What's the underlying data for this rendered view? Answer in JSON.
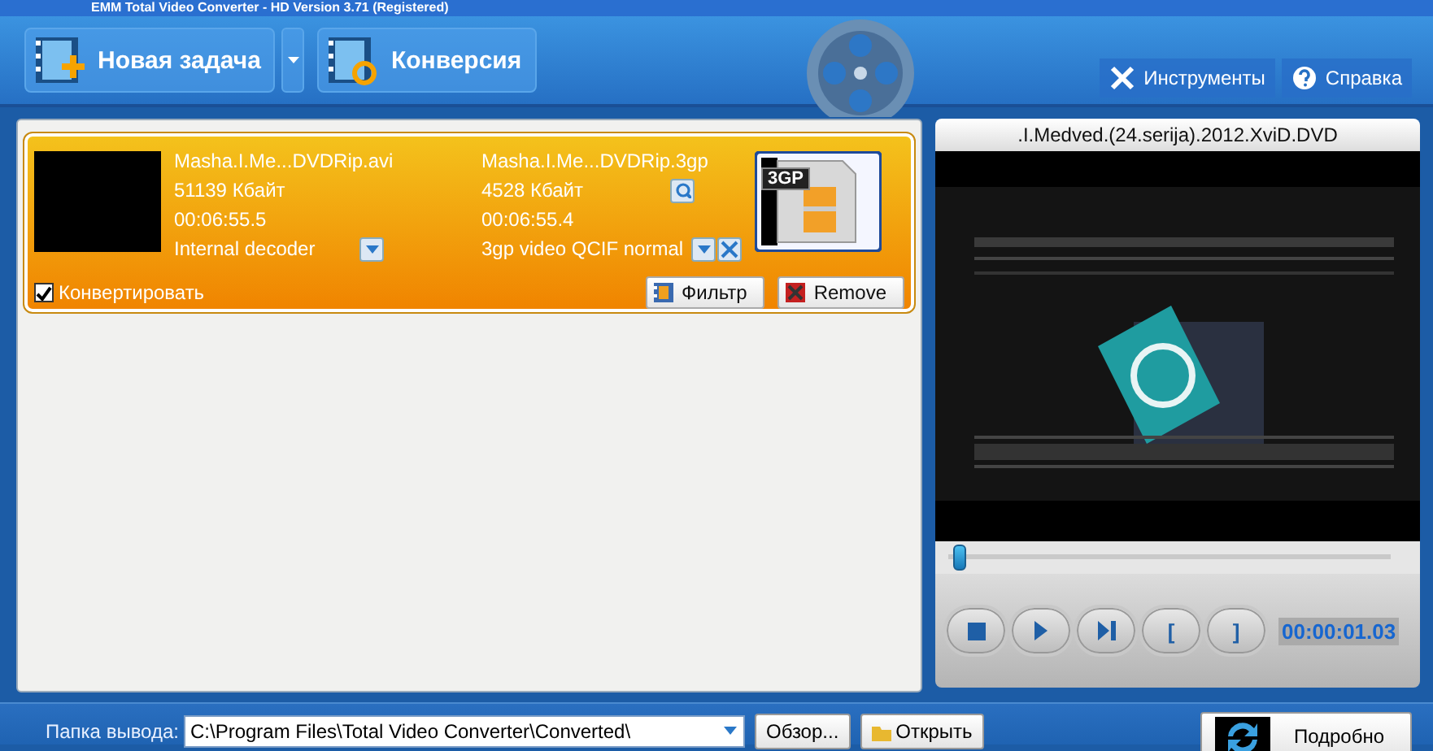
{
  "window": {
    "title": "EMM Total Video Converter - HD Version 3.71 (Registered)"
  },
  "toolbar": {
    "buttons": [
      {
        "label": "Новая задача",
        "kind": "new"
      },
      {
        "label": "Конверсия",
        "kind": "convert"
      }
    ],
    "links": [
      {
        "label": "Инструменты",
        "kind": "tools"
      },
      {
        "label": "Справка",
        "kind": "help"
      }
    ]
  },
  "tasks": [
    {
      "selected": true,
      "source": {
        "name": "Masha.I.Me...DVDRip.avi",
        "size": "51139 Кбайт",
        "duration": "00:06:55.5",
        "decoder": "Internal decoder"
      },
      "output": {
        "name": "Masha.I.Me...DVDRip.3gp",
        "size": "4528 Кбайт",
        "duration": "00:06:55.4",
        "profile": "3gp video QCIF normal"
      },
      "format_badge": "3GP",
      "convert": {
        "label": "Конвертировать",
        "checked": true
      },
      "buttons": [
        {
          "label": "Фильтр",
          "kind": "filter"
        },
        {
          "label": "Remove",
          "kind": "remove"
        }
      ]
    }
  ],
  "preview": {
    "title": ".I.Medved.(24.serija).2012.XviD.DVD",
    "seek": {
      "level": 0.01
    },
    "controls": [
      {
        "kind": "stop"
      },
      {
        "kind": "play"
      },
      {
        "kind": "next"
      },
      {
        "kind": "mark",
        "label": "["
      },
      {
        "kind": "mark",
        "label": "]"
      }
    ],
    "time": "00:00:01.03"
  },
  "output_bar": {
    "label": "Папка вывода:",
    "path": "C:\\Program Files\\Total Video Converter\\Converted\\",
    "buttons": [
      {
        "label": "Обзор...",
        "kind": "browse"
      },
      {
        "label": "Открыть",
        "kind": "open"
      },
      {
        "label": "Подробно",
        "kind": "details"
      }
    ]
  }
}
